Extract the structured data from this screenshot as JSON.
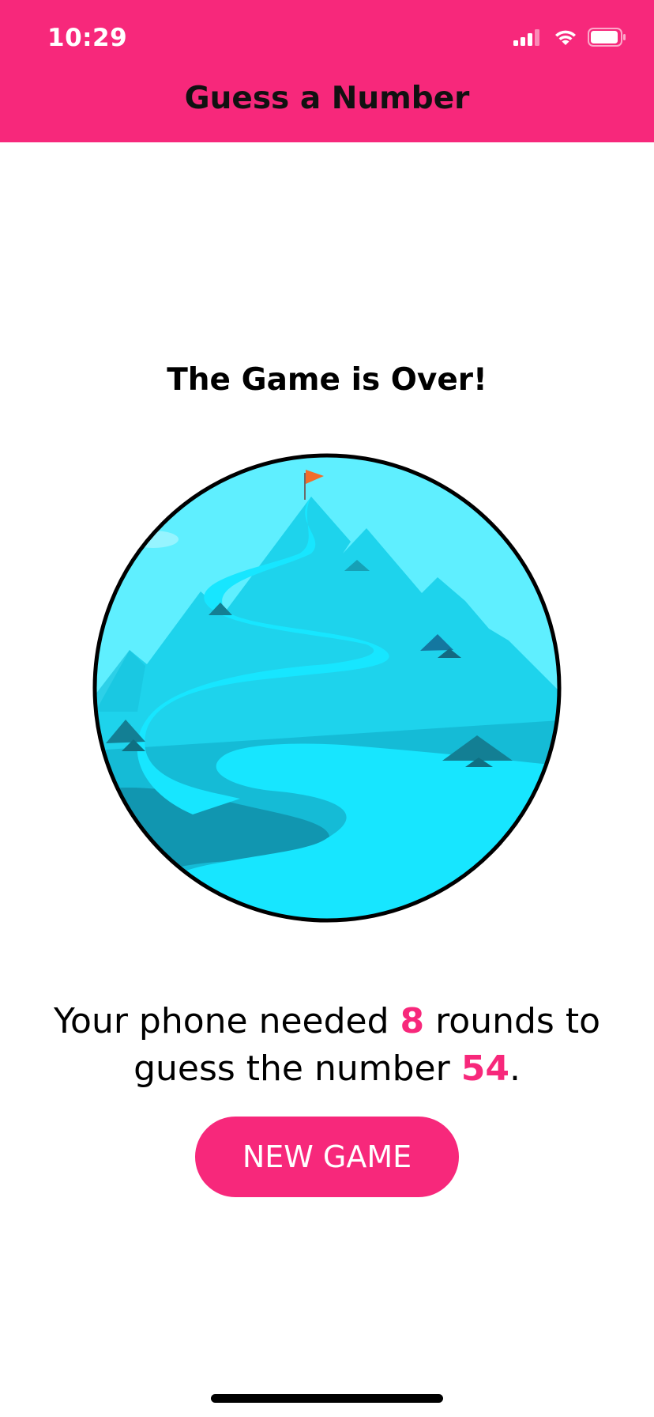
{
  "status_bar": {
    "time": "10:29",
    "icons": [
      "cellular-signal-icon",
      "wifi-icon",
      "battery-icon"
    ]
  },
  "header": {
    "title": "Guess a Number"
  },
  "main": {
    "title": "The Game is Over!",
    "image_icon": "mountain-summit-flag-illustration",
    "result": {
      "prefix": "Your phone needed ",
      "rounds": "8",
      "middle": " rounds to guess the number ",
      "number": "54",
      "suffix": "."
    },
    "new_game_label": "NEW GAME"
  },
  "colors": {
    "accent": "#f7287b",
    "background": "#ffffff",
    "sky": "#5fefff",
    "path": "#17e6ff",
    "flag": "#f26c2a"
  }
}
